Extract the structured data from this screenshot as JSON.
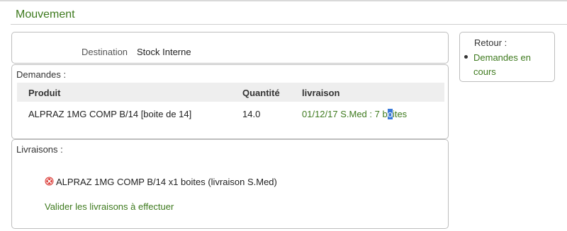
{
  "page": {
    "title": "Mouvement"
  },
  "destination": {
    "label": "Destination",
    "value": "Stock Interne"
  },
  "demandes": {
    "label": "Demandes :",
    "headers": {
      "produit": "Produit",
      "quantite": "Quantité",
      "livraison": "livraison"
    },
    "rows": [
      {
        "produit": "ALPRAZ 1MG COMP B/14 [boite de 14]",
        "quantite": "14.0",
        "livraison_before": "01/12/17 S.Med : 7 b",
        "livraison_selected": "o",
        "livraison_after": "ites"
      }
    ]
  },
  "livraisons": {
    "label": "Livraisons :",
    "items": [
      {
        "icon": "remove-icon",
        "text": "ALPRAZ 1MG COMP B/14 x1 boites (livraison S.Med)"
      }
    ],
    "action": "Valider les livraisons à effectuer"
  },
  "retour": {
    "label": "Retour :",
    "links": [
      "Demandes en cours"
    ]
  },
  "colors": {
    "link": "#3e7a1e",
    "remove_icon": "#d9302b",
    "header_bg": "#eeeeee",
    "selection": "#3a79d8"
  }
}
